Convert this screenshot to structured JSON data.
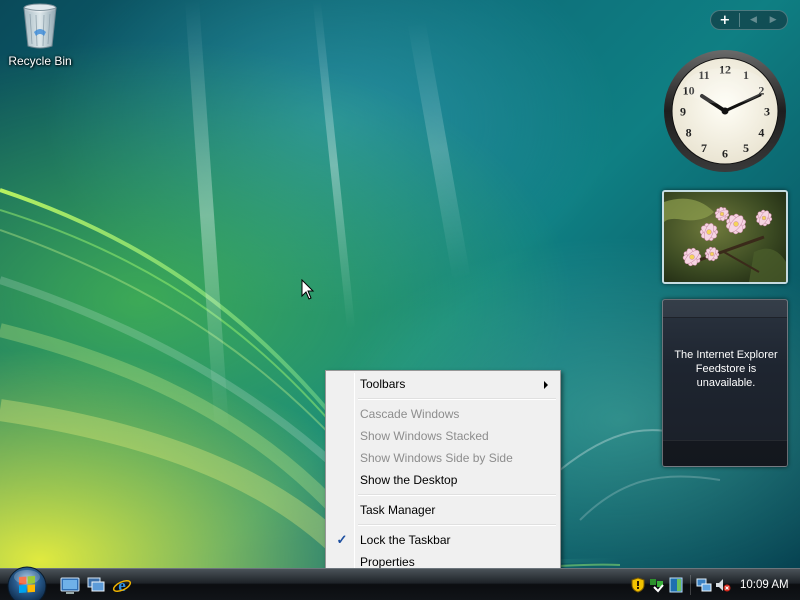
{
  "desktop": {
    "icons": [
      {
        "label": "Recycle Bin",
        "icon": "recycle-bin-icon"
      }
    ]
  },
  "sidebar": {
    "controls": {
      "add_symbol": "+",
      "prev_symbol": "◀",
      "next_symbol": "▶"
    },
    "clock": {
      "numbers": [
        "12",
        "1",
        "2",
        "3",
        "4",
        "5",
        "6",
        "7",
        "8",
        "9",
        "10",
        "11"
      ],
      "time": "10:09"
    },
    "slideshow": {
      "subject": "pink frangipani flowers"
    },
    "feed": {
      "message": "The Internet Explorer Feedstore is unavailable."
    }
  },
  "context_menu": {
    "items": [
      {
        "label": "Toolbars",
        "enabled": true,
        "submenu": true
      },
      {
        "label": "Cascade Windows",
        "enabled": false
      },
      {
        "label": "Show Windows Stacked",
        "enabled": false
      },
      {
        "label": "Show Windows Side by Side",
        "enabled": false
      },
      {
        "label": "Show the Desktop",
        "enabled": true
      },
      {
        "label": "Task Manager",
        "enabled": true
      },
      {
        "label": "Lock the Taskbar",
        "enabled": true,
        "checked": true,
        "check_symbol": "✓"
      },
      {
        "label": "Properties",
        "enabled": true
      }
    ]
  },
  "taskbar": {
    "start_button": "start-orb-icon",
    "quick_launch": [
      "show-desktop-icon",
      "switch-windows-icon",
      "internet-explorer-icon"
    ],
    "tray_icons": [
      "security-shield-icon",
      "windows-update-icon",
      "sidebar-icon",
      "network-icon",
      "volume-muted-icon"
    ],
    "clock": "10:09 AM"
  },
  "colors": {
    "menu_background": "#f0f0f0",
    "menu_disabled_text": "#8d8d8d",
    "check_color": "#1d4fa0"
  }
}
